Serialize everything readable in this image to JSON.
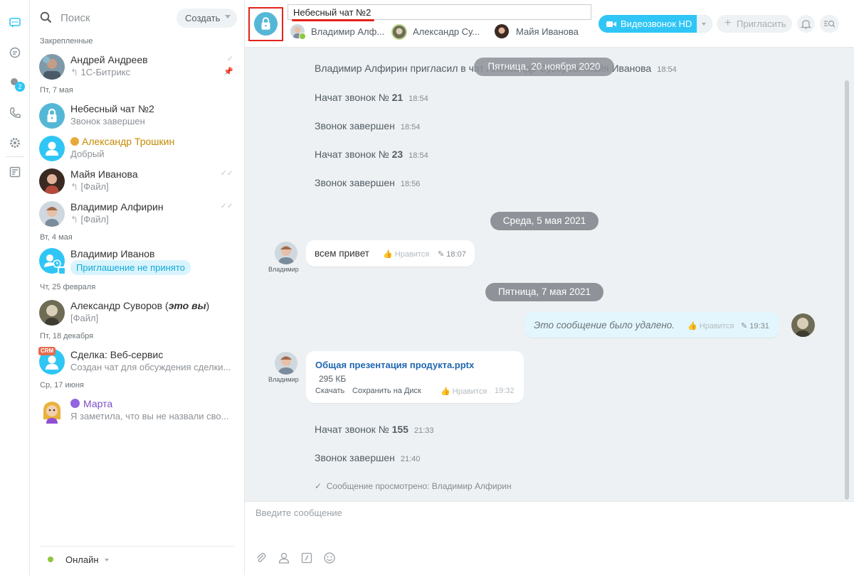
{
  "sidebar_rail": {
    "icons": [
      "chat-icon",
      "channels-icon",
      "notifications-icon",
      "phone-icon",
      "settings-icon",
      "tasks-icon"
    ],
    "notifications_badge": "2"
  },
  "recent": {
    "search_placeholder": "Поиск",
    "create_label": "Создать",
    "sections": {
      "pinned": "Закрепленные",
      "fri_7_may": "Пт, 7 мая",
      "tue_4_may": "Вт, 4 мая",
      "thu_25_feb": "Чт, 25 февраля",
      "fri_18_dec": "Пт, 18 декабря",
      "wed_17_jun": "Ср, 17 июня"
    },
    "items": [
      {
        "name": "Андрей Андреев",
        "sub": "1С-Битрикс"
      },
      {
        "name": "Небесный чат №2",
        "sub": "Звонок завершен"
      },
      {
        "name": "Александр Трошкин",
        "sub": "Добрый"
      },
      {
        "name": "Майя Иванова",
        "sub": "[Файл]"
      },
      {
        "name": "Владимир Алфирин",
        "sub": "[Файл]"
      },
      {
        "name": "Владимир Иванов",
        "sub": "Приглашение не принято"
      },
      {
        "name": "Александр Суворов (",
        "name_em": "это вы",
        "name_end": ")",
        "sub": "[Файл]"
      },
      {
        "name": "Сделка: Веб-сервис",
        "sub": "Создан чат для обсуждения сделки...",
        "badge": "CRM"
      },
      {
        "name": "Марта",
        "sub": "Я заметила, что вы не назвали сво..."
      }
    ],
    "status_label": "Онлайн"
  },
  "chat_header": {
    "title": "Небесный чат №2",
    "members": [
      "Владимир Алф...",
      "Александр Су...",
      "Майя Иванова"
    ],
    "video_call_label": "Видеозвонок HD",
    "invite_label": "Пригласить"
  },
  "messages": {
    "system": [
      {
        "text": "Владимир Алфирин пригласил в чат Александр Суворов, Майя Иванова",
        "time": "18:54"
      },
      {
        "text": "Начат звонок № ",
        "num": "21",
        "time": "18:54"
      },
      {
        "text": "Звонок завершен",
        "time": "18:54"
      },
      {
        "text": "Начат звонок № ",
        "num": "23",
        "time": "18:54"
      },
      {
        "text": "Звонок завершен",
        "time": "18:56"
      },
      {
        "text": "Начат звонок № ",
        "num": "155",
        "time": "21:33"
      },
      {
        "text": "Звонок завершен",
        "time": "21:40"
      }
    ],
    "dates": [
      "Пятница, 20 ноября 2020",
      "Среда, 5 мая 2021",
      "Пятница, 7 мая 2021"
    ],
    "bubble1": {
      "author": "Владимир",
      "text": "всем привет",
      "like": "Нравится",
      "time": "18:07"
    },
    "bubble2": {
      "text": "Это сообщение было удалено.",
      "like": "Нравится",
      "time": "19:31"
    },
    "file": {
      "author": "Владимир",
      "name": "Общая презентация продукта.pptx",
      "size": "295 КБ",
      "download": "Скачать",
      "save": "Сохранить на Диск",
      "like": "Нравится",
      "time": "19:32"
    },
    "viewed": "Сообщение просмотрено: Владимир Алфирин"
  },
  "composer": {
    "placeholder": "Введите сообщение",
    "icons": [
      "paperclip-icon",
      "user-icon",
      "command-icon",
      "smile-icon"
    ]
  },
  "colors": {
    "accent": "#2fc6f6",
    "brand": "#55b7d6",
    "highlight": "#e2231a"
  }
}
